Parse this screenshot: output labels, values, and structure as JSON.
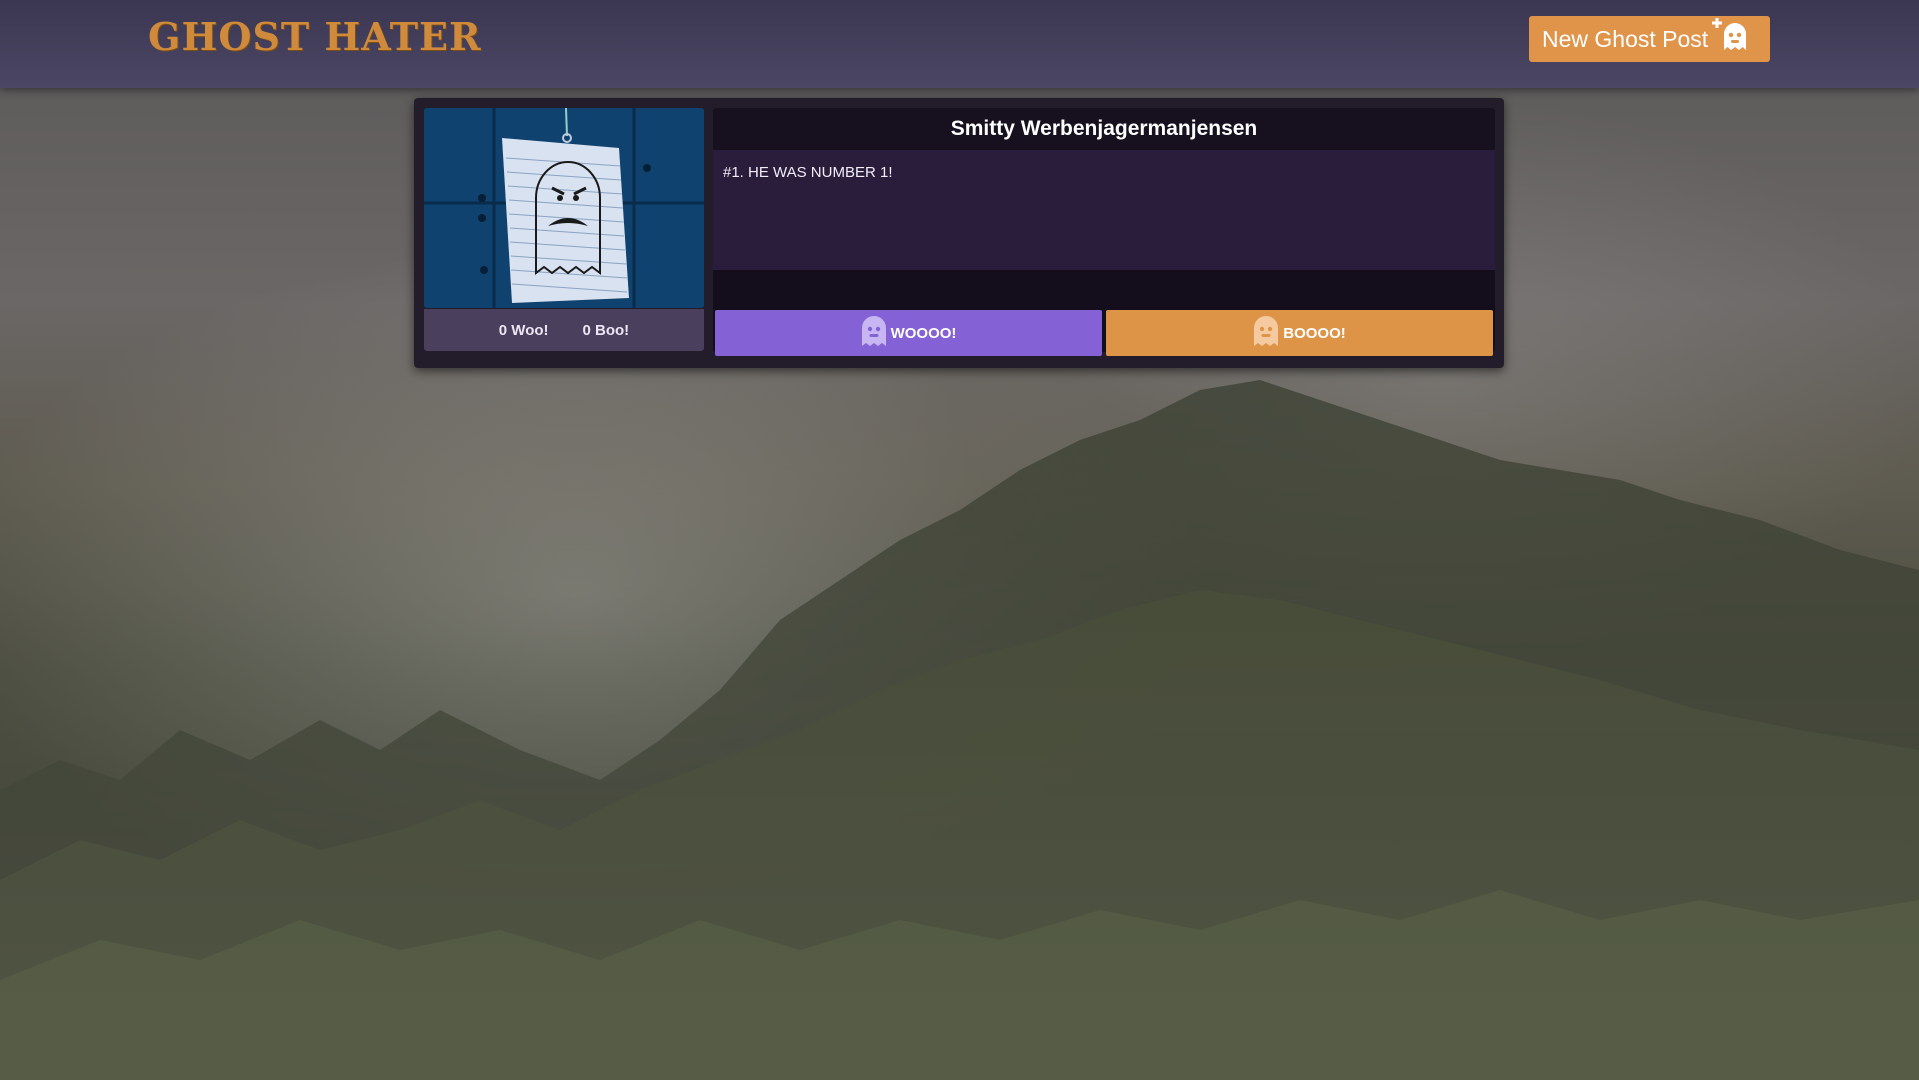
{
  "navbar": {
    "logo": "GHOST HATER",
    "new_post_label": "New Ghost Post",
    "new_post_icon": "ghost-plus-icon"
  },
  "post": {
    "author": "Smitty Werbenjagermanjensen",
    "body": "#1. HE WAS NUMBER 1!",
    "woo_count": "0 Woo!",
    "boo_count": "0 Boo!",
    "woo_button": "WOOOO!",
    "boo_button": "BOOOO!",
    "thumbnail": "angry-ghost-drawing-note"
  },
  "colors": {
    "accent_orange": "#e0944a",
    "accent_purple": "#8462d6",
    "navbar": "#3b3752",
    "logo": "#cf8a3c"
  }
}
